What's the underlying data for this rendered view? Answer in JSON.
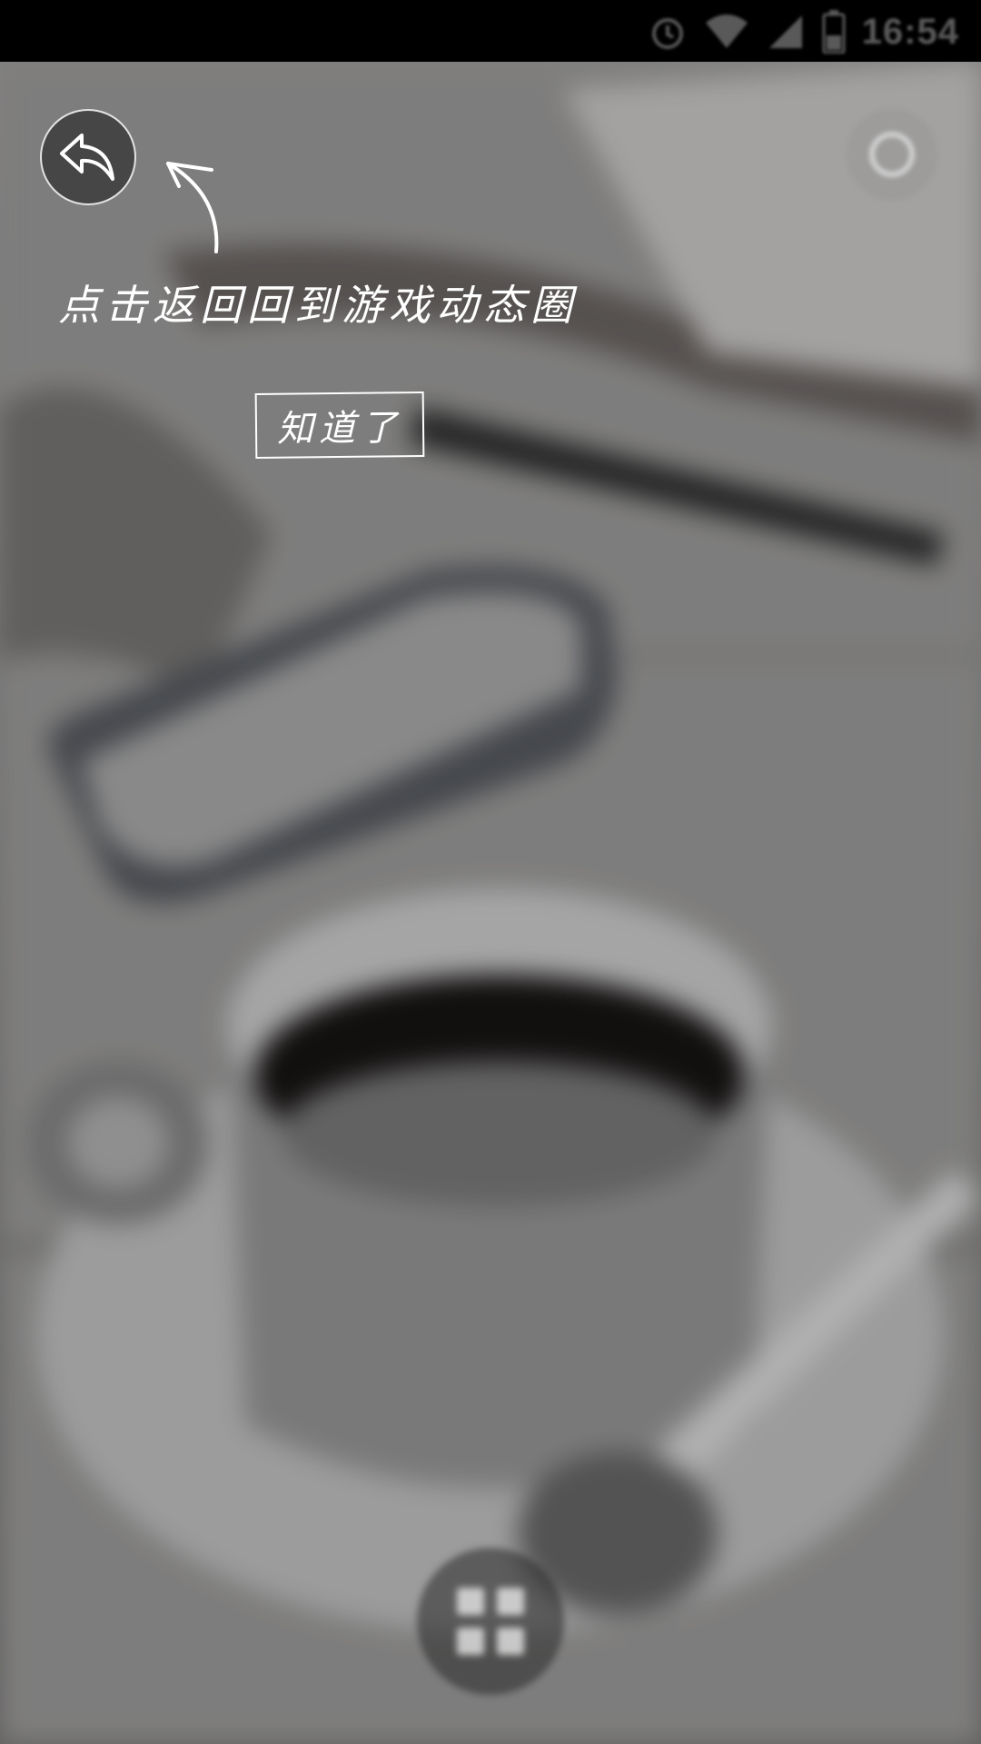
{
  "status_bar": {
    "time": "16:54",
    "icons": [
      "alarm-icon",
      "wifi-icon",
      "signal-icon",
      "battery-icon"
    ]
  },
  "guide": {
    "hint_text": "点击返回回到游戏动态圈",
    "ok_label": "知道了"
  },
  "buttons": {
    "back_icon": "reply-arrow-icon",
    "top_right_icon": "circle-icon",
    "bottom_icon": "grid-icon"
  },
  "colors": {
    "overlay": "#000000",
    "guide_text": "#ffffff"
  }
}
